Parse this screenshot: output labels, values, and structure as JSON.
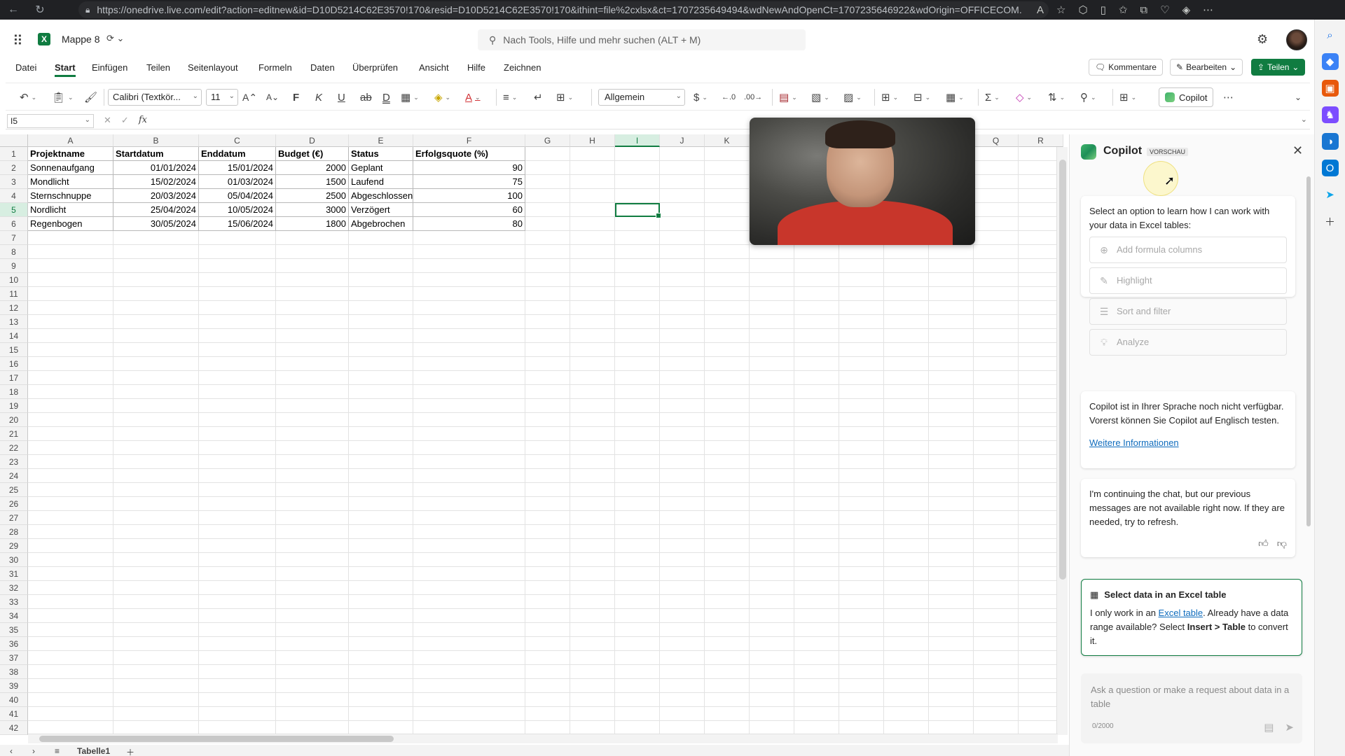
{
  "browser": {
    "url": "https://onedrive.live.com/edit?action=editnew&id=D10D5214C62E3570!170&resid=D10D5214C62E3570!170&ithint=file%2cxlsx&ct=1707235649494&wdNewAndOpenCt=1707235646922&wdOrigin=OFFICECOM..."
  },
  "app": {
    "doc_title": "Mappe 8",
    "search_placeholder": "Nach Tools, Hilfe und mehr suchen (ALT + M)"
  },
  "menu": {
    "tabs": [
      "Datei",
      "Start",
      "Einfügen",
      "Teilen",
      "Seitenlayout",
      "Formeln",
      "Daten",
      "Überprüfen",
      "Ansicht",
      "Hilfe",
      "Zeichnen"
    ],
    "active": "Start",
    "comments_label": "Kommentare",
    "edit_label": "Bearbeiten",
    "share_label": "Teilen"
  },
  "ribbon": {
    "font": "Calibri (Textkör...",
    "size": "11",
    "number_format": "Allgemein",
    "copilot_label": "Copilot",
    "bold_glyph": "F",
    "italic_glyph": "K",
    "underline_glyph": "U",
    "doubleunderline_glyph": "D"
  },
  "formula_bar": {
    "name_box": "I5",
    "fx": "fx",
    "value": ""
  },
  "sheet": {
    "columns": [
      "A",
      "B",
      "C",
      "D",
      "E",
      "F",
      "G",
      "H",
      "I",
      "J",
      "K",
      "L",
      "M",
      "N",
      "O",
      "P",
      "Q",
      "R"
    ],
    "selected_column": "I",
    "selected_row": 5,
    "row_count": 42,
    "table": {
      "headers": [
        "Projektname",
        "Startdatum",
        "Enddatum",
        "Budget (€)",
        "Status",
        "Erfolgsquote (%)"
      ],
      "rows": [
        [
          "Sonnenaufgang",
          "01/01/2024",
          "15/01/2024",
          "2000",
          "Geplant",
          "90"
        ],
        [
          "Mondlicht",
          "15/02/2024",
          "01/03/2024",
          "1500",
          "Laufend",
          "75"
        ],
        [
          "Sternschnuppe",
          "20/03/2024",
          "05/04/2024",
          "2500",
          "Abgeschlossen",
          "100"
        ],
        [
          "Nordlicht",
          "25/04/2024",
          "10/05/2024",
          "3000",
          "Verzögert",
          "60"
        ],
        [
          "Regenbogen",
          "30/05/2024",
          "15/06/2024",
          "1800",
          "Abgebrochen",
          "80"
        ]
      ]
    },
    "tab_name": "Tabelle1"
  },
  "copilot": {
    "title": "Copilot",
    "badge": "VORSCHAU",
    "intro": "Select an option to learn how I can work with your data in Excel tables:",
    "options": [
      "Add formula columns",
      "Highlight",
      "Sort and filter",
      "Analyze"
    ],
    "lang_notice": "Copilot ist in Ihrer Sprache noch nicht verfügbar. Vorerst können Sie Copilot auf Englisch testen.",
    "lang_link": "Weitere Informationen",
    "continue_msg": "I'm continuing the chat, but our previous messages are not available right now. If they are needed, try to refresh.",
    "excel_card_title": "Select data in an Excel table",
    "excel_card_pre": "I only work in an ",
    "excel_card_link": "Excel table",
    "excel_card_mid": ". Already have a data range available? Select ",
    "excel_card_bold": "Insert > Table",
    "excel_card_post": " to convert it.",
    "input_placeholder": "Ask a question or make a request about data in a table",
    "char_count": "0/2000"
  }
}
